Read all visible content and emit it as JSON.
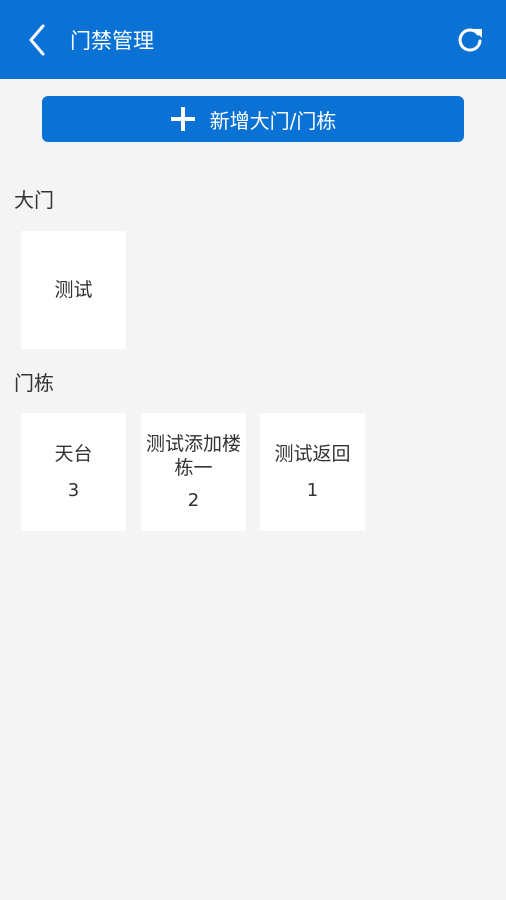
{
  "header": {
    "title": "门禁管理",
    "back_icon": "chevron-left-icon",
    "refresh_icon": "refresh-icon",
    "bg_color": "#0a72d4"
  },
  "add_button": {
    "label": "新增大门/门栋",
    "icon": "plus-icon"
  },
  "gates": {
    "label": "大门",
    "items": [
      {
        "name": "测试"
      }
    ]
  },
  "buildings": {
    "label": "门栋",
    "items": [
      {
        "name": "天台",
        "count": "3"
      },
      {
        "name": "测试添加楼栋一",
        "count": "2"
      },
      {
        "name": "测试返回",
        "count": "1"
      }
    ]
  }
}
